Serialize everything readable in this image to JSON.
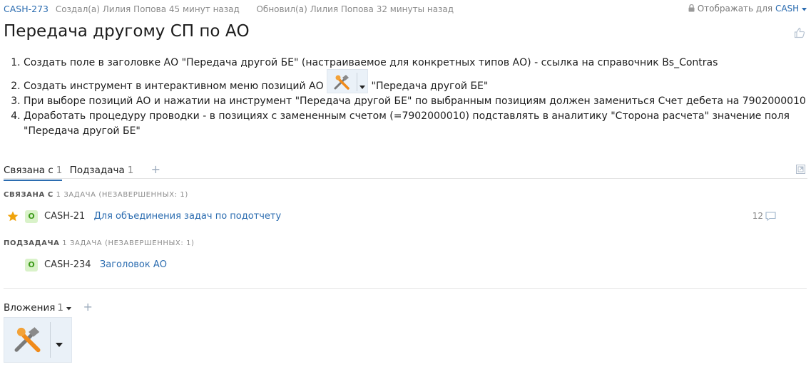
{
  "issue": {
    "key": "CASH-273",
    "created": "Создал(а) Лилия Попова 45 минут назад",
    "updated": "Обновил(а) Лилия Попова 32 минуты назад",
    "visibility_label": "Отображать для",
    "visibility_project": "CASH",
    "title": "Передача другому СП по АО"
  },
  "description": {
    "item1": "Создать поле в заголовке АО \"Передача другой БЕ\" (настраиваемое для конкретных типов АО) - ссылка на справочник Bs_Contras",
    "item2_before": "Создать инструмент в интерактивном меню позиций АО",
    "item2_after": "\"Передача другой БЕ\"",
    "item3": "При выборе позиций АО и нажатии на инструмент \"Передача другой БЕ\" по выбранным позициям должен замениться Счет дебета на 7902000010",
    "item4": "Доработать процедуру проводки - в позициях с замененным счетом (=7902000010) подставлять в аналитику \"Сторона расчета\" значение поля \"Передача другой БЕ\""
  },
  "tabs": [
    {
      "label": "Связана с",
      "count": "1"
    },
    {
      "label": "Подзадача",
      "count": "1"
    }
  ],
  "links": {
    "related_heading": "СВЯЗАНА С",
    "related_count": "1 ЗАДАЧА (НЕЗАВЕРШЕННЫХ: 1)",
    "related_item": {
      "state": "O",
      "key": "CASH-21",
      "summary": "Для объединения задач по подотчету",
      "comments": "12"
    },
    "subtask_heading": "ПОДЗАДАЧА",
    "subtask_count": "1 ЗАДАЧА (НЕЗАВЕРШЕННЫХ: 1)",
    "subtask_item": {
      "state": "O",
      "key": "CASH-234",
      "summary": "Заголовок АО"
    }
  },
  "attachments": {
    "label": "Вложения",
    "count": "1"
  },
  "colors": {
    "link": "#2b6cb0",
    "badge_bg": "#d9f2c9",
    "badge_fg": "#3d9b1a",
    "star": "#f0a30a"
  },
  "icons": [
    "lock-icon",
    "like-icon",
    "tool-icon",
    "caret-down-icon",
    "plus-icon",
    "expand-icon",
    "star-icon",
    "comment-icon"
  ]
}
